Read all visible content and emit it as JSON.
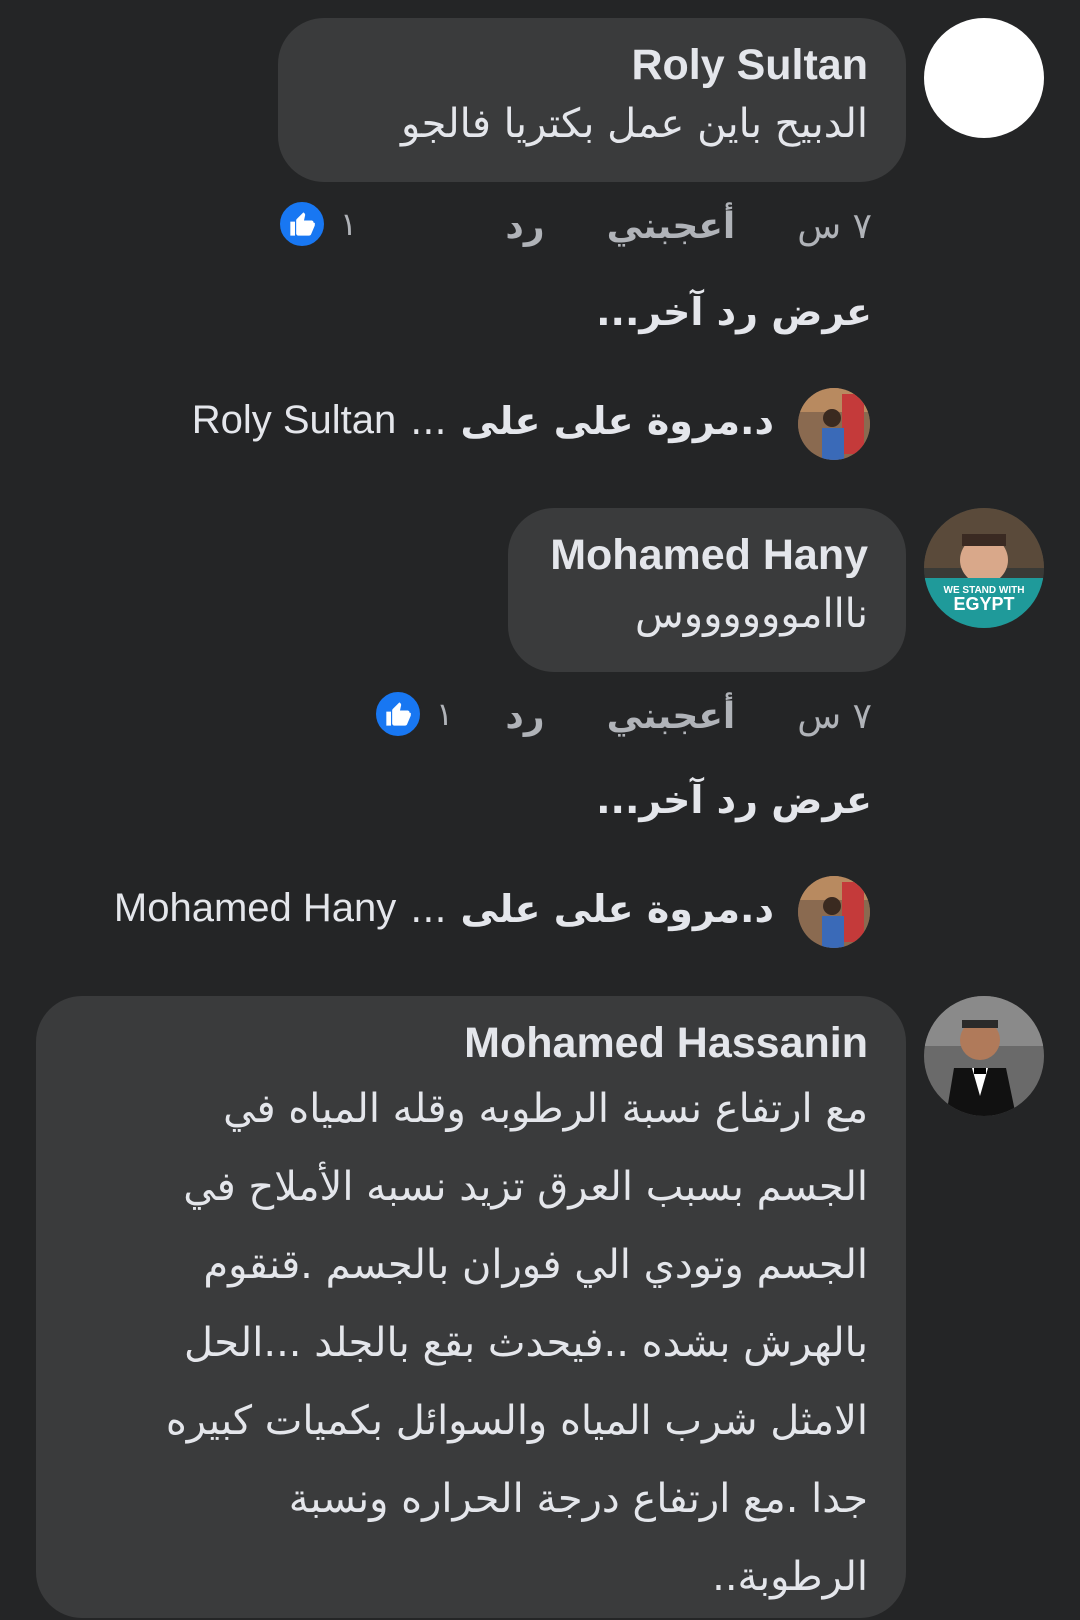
{
  "comments": [
    {
      "author": "Roly Sultan",
      "text": "الدبيح باين عمل بكتريا فالجو",
      "time": "٧ س",
      "like_label": "أعجبني",
      "reply_label": "رد",
      "reaction_count": "١",
      "more_replies": "عرض رد آخر...",
      "reply_preview": {
        "author": "د.مروة على على",
        "ellipsis": "...",
        "target": "Roly Sultan"
      }
    },
    {
      "author": "Mohamed Hany",
      "text": "نااامووووووس",
      "time": "٧ س",
      "like_label": "أعجبني",
      "reply_label": "رد",
      "reaction_count": "١",
      "more_replies": "عرض رد آخر...",
      "reply_preview": {
        "author": "د.مروة على على",
        "ellipsis": "...",
        "target": "Mohamed Hany"
      },
      "avatar_badge_text": "WE STAND WITH",
      "avatar_badge_title": "EGYPT"
    },
    {
      "author": "Mohamed Hassanin",
      "lines": [
        "مع ارتفاع نسبة الرطوبه وقله المياه  في",
        "الجسم بسبب  العرق تزيد نسبه الأملاح في",
        "الجسم وتودي الي فوران بالجسم .قنقوم",
        "بالهرش بشده ..فيحدث بقع بالجلد ...الحل",
        "الامثل شرب المياه والسوائل بكميات كبيره",
        "جدا .مع ارتفاع درجة الحراره ونسبة",
        "الرطوبة.."
      ]
    }
  ],
  "colors": {
    "background": "#242526",
    "bubble": "#3a3b3c",
    "primary_text": "#e4e6eb",
    "secondary_text": "#b0b3b8",
    "like_blue": "#1877f2"
  }
}
